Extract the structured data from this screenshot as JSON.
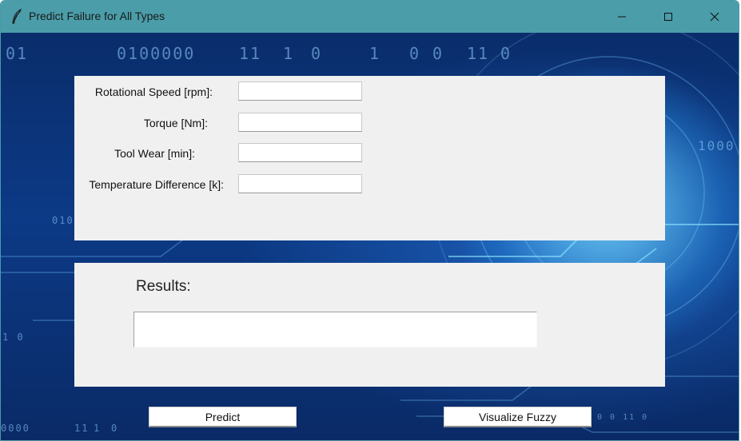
{
  "window": {
    "title": "Predict Failure for All Types",
    "titlebar_color": "#4a9da9"
  },
  "background": {
    "digit_rows": [
      "01",
      "0100000",
      "11",
      "1",
      "0",
      "1",
      "0",
      "0",
      "11",
      "0",
      "1000",
      "010",
      "1 0",
      "0000",
      "11",
      "1",
      "0",
      "0  0  11 0"
    ]
  },
  "form": {
    "fields": [
      {
        "label": "Rotational Speed [rpm]:",
        "value": ""
      },
      {
        "label": "Torque [Nm]:",
        "value": ""
      },
      {
        "label": "Tool Wear [min]:",
        "value": ""
      },
      {
        "label": "Temperature Difference [k]:",
        "value": ""
      }
    ]
  },
  "results": {
    "label": "Results:",
    "value": ""
  },
  "buttons": {
    "predict": "Predict",
    "visualize": "Visualize Fuzzy"
  }
}
